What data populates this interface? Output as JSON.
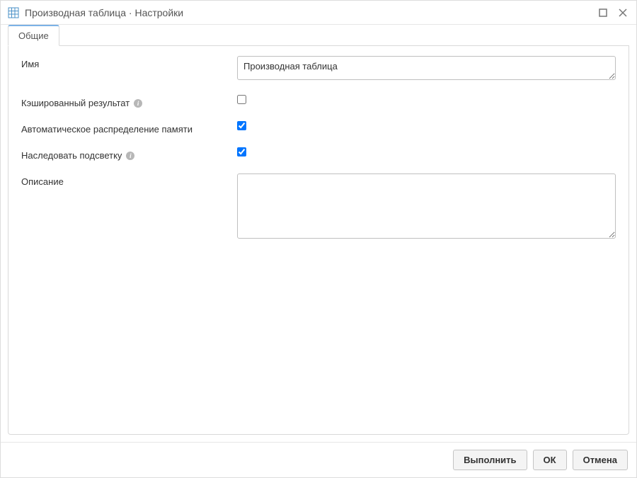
{
  "titlebar": {
    "title": "Производная таблица · Настройки"
  },
  "tabs": {
    "general": "Общие"
  },
  "form": {
    "name_label": "Имя",
    "name_value": "Производная таблица",
    "cached_result_label": "Кэшированный результат",
    "cached_result_checked": false,
    "auto_memory_label": "Автоматическое распределение памяти",
    "auto_memory_checked": true,
    "inherit_highlight_label": "Наследовать подсветку",
    "inherit_highlight_checked": true,
    "description_label": "Описание",
    "description_value": ""
  },
  "footer": {
    "execute": "Выполнить",
    "ok": "ОК",
    "cancel": "Отмена"
  },
  "info_glyph": "i"
}
